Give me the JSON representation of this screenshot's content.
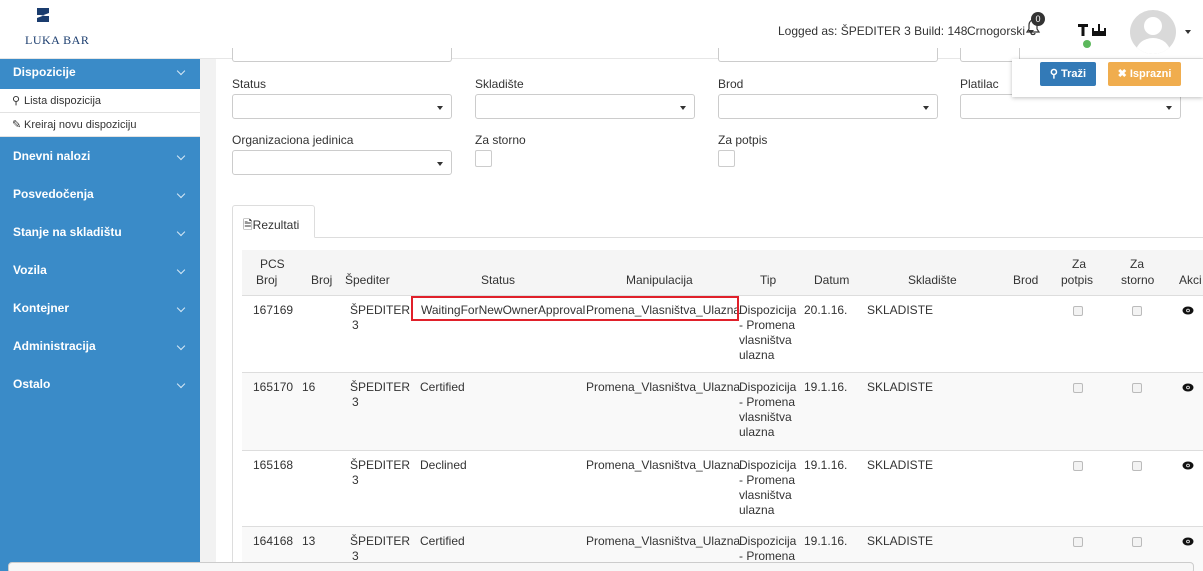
{
  "header": {
    "logo_text": "LUKA BAR",
    "logged_label": "Logged as: ŠPEDITER 3",
    "build_label": "Build: 148",
    "language": "Crnogorski",
    "notification_count": "0"
  },
  "sidebar": {
    "items": [
      {
        "label": "Dispozicije"
      },
      {
        "label": "Dnevni nalozi"
      },
      {
        "label": "Posvedočenja"
      },
      {
        "label": "Stanje na skladištu"
      },
      {
        "label": "Vozila"
      },
      {
        "label": "Kontejner"
      },
      {
        "label": "Administracija"
      },
      {
        "label": "Ostalo"
      }
    ],
    "sub_items": [
      {
        "label": "Lista dispozicija"
      },
      {
        "label": "Kreiraj novu dispoziciju"
      }
    ]
  },
  "filters": {
    "status_label": "Status",
    "skladiste_label": "Skladište",
    "brod_label": "Brod",
    "platilac_label": "Platilac",
    "org_label": "Organizaciona jedinica",
    "za_storno_label": "Za storno",
    "za_potpis_label": "Za potpis",
    "search_button": "Traži",
    "clear_button": "Isprazni"
  },
  "tabs": {
    "results": "Rezultati"
  },
  "table": {
    "headers": {
      "pcs": "PCS",
      "pcs2": "Broj",
      "broj": "Broj",
      "spediter": "Špediter",
      "status": "Status",
      "manipulacija": "Manipulacija",
      "tip": "Tip",
      "datum": "Datum",
      "skladiste": "Skladište",
      "brod": "Brod",
      "za_potpis1": "Za",
      "za_potpis2": "potpis",
      "za_storno1": "Za",
      "za_storno2": "storno",
      "akcije": "Akci"
    },
    "rows": [
      {
        "pcs": "167169",
        "broj": "",
        "spediter1": "ŠPEDITER",
        "spediter2": "3",
        "status": "WaitingForNewOwnerApproval",
        "manipulacija": "Promena_Vlasništva_Ulazna",
        "tip1": "Dispozicija",
        "tip2": "- Promena",
        "tip3": "vlasništva",
        "tip4": "ulazna",
        "datum": "20.1.16.",
        "skladiste": "SKLADISTE"
      },
      {
        "pcs": "165170",
        "broj": "16",
        "spediter1": "ŠPEDITER",
        "spediter2": "3",
        "status": "Certified",
        "manipulacija": "Promena_Vlasništva_Ulazna",
        "tip1": "Dispozicija",
        "tip2": "- Promena",
        "tip3": "vlasništva",
        "tip4": "ulazna",
        "datum": "19.1.16.",
        "skladiste": "SKLADISTE"
      },
      {
        "pcs": "165168",
        "broj": "",
        "spediter1": "ŠPEDITER",
        "spediter2": "3",
        "status": "Declined",
        "manipulacija": "Promena_Vlasništva_Ulazna",
        "tip1": "Dispozicija",
        "tip2": "- Promena",
        "tip3": "vlasništva",
        "tip4": "ulazna",
        "datum": "19.1.16.",
        "skladiste": "SKLADISTE"
      },
      {
        "pcs": "164168",
        "broj": "13",
        "spediter1": "ŠPEDITER",
        "spediter2": "3",
        "status": "Certified",
        "manipulacija": "Promena_Vlasništva_Ulazna",
        "tip1": "Dispozicija",
        "tip2": "- Promena",
        "tip3": "",
        "tip4": "",
        "datum": "19.1.16.",
        "skladiste": "SKLADISTE"
      }
    ]
  },
  "colors": {
    "sidebar": "#3a8bc8",
    "primary": "#337ab7",
    "warning": "#f0ad4e",
    "highlight": "#e0202a"
  },
  "icons": {
    "logo": "luka-bar-logo",
    "bell": "bell-icon",
    "tools": "tools-icon",
    "eye": "eye-icon"
  }
}
